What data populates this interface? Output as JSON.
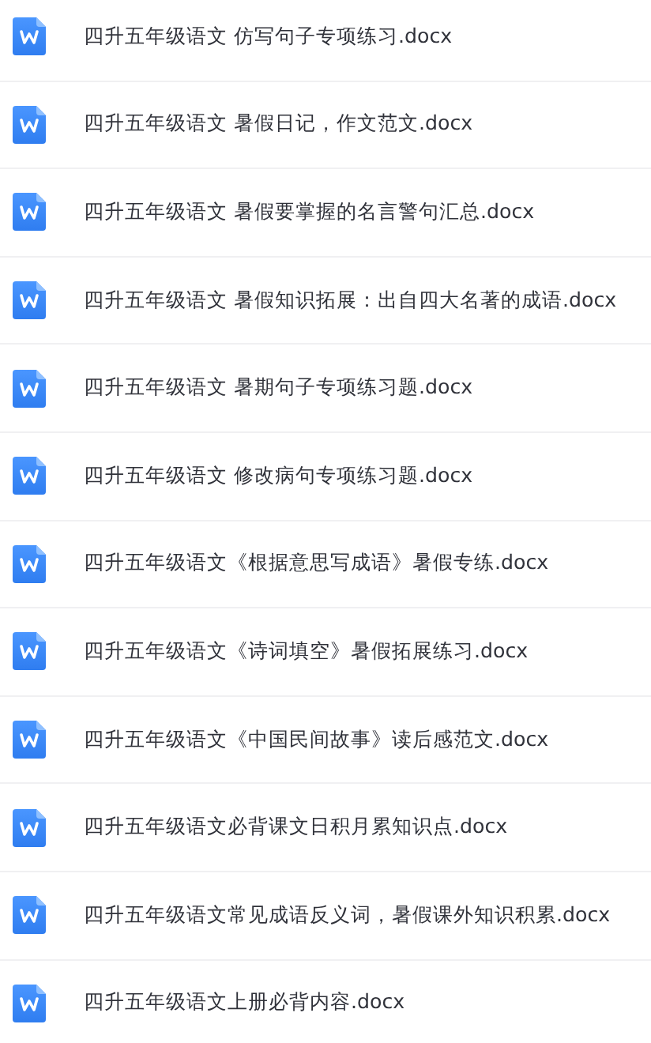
{
  "files": [
    {
      "name": "四升五年级语文 仿写句子专项练习.docx"
    },
    {
      "name": "四升五年级语文 暑假日记，作文范文.docx"
    },
    {
      "name": "四升五年级语文 暑假要掌握的名言警句汇总.docx"
    },
    {
      "name": "四升五年级语文 暑假知识拓展：出自四大名著的成语.docx"
    },
    {
      "name": "四升五年级语文 暑期句子专项练习题.docx"
    },
    {
      "name": "四升五年级语文 修改病句专项练习题.docx"
    },
    {
      "name": "四升五年级语文《根据意思写成语》暑假专练.docx"
    },
    {
      "name": "四升五年级语文《诗词填空》暑假拓展练习.docx"
    },
    {
      "name": "四升五年级语文《中国民间故事》读后感范文.docx"
    },
    {
      "name": "四升五年级语文必背课文日积月累知识点.docx"
    },
    {
      "name": "四升五年级语文常见成语反义词，暑假课外知识积累.docx"
    },
    {
      "name": "四升五年级语文上册必背内容.docx"
    }
  ]
}
